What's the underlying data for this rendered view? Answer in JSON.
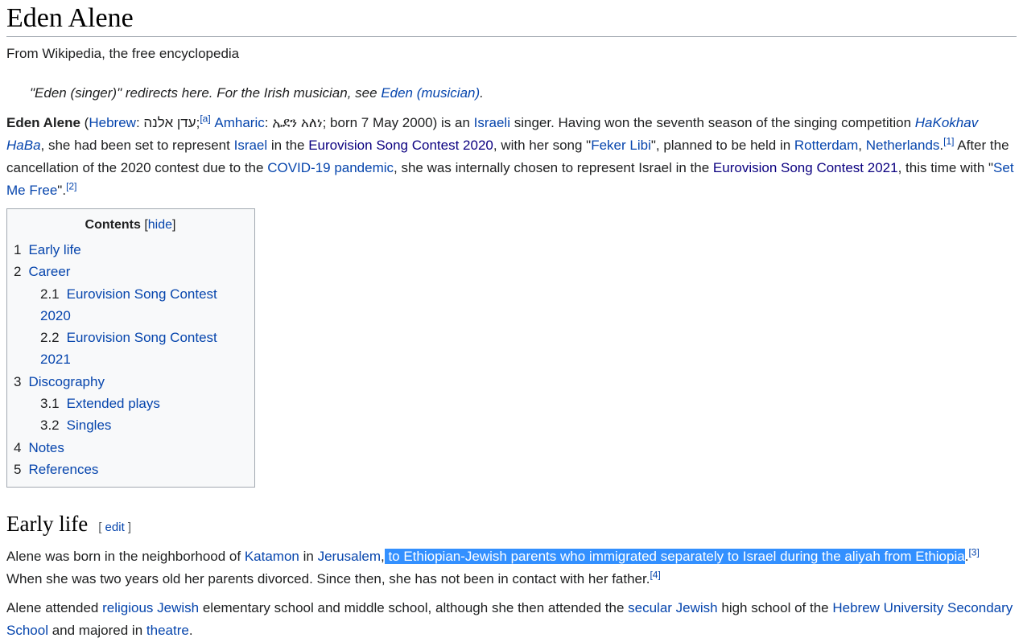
{
  "page": {
    "title": "Eden Alene",
    "tagline": "From Wikipedia, the free encyclopedia"
  },
  "hatnote": {
    "text": "\"Eden (singer)\" redirects here. For the Irish musician, see ",
    "link": "Eden (musician)",
    "end": "."
  },
  "lead": {
    "name": "Eden Alene",
    "t1": " (",
    "hebrew_link": "Hebrew",
    "t2": ": עדן אלנה;",
    "note_a": "[a]",
    "amharic_link": "Amharic",
    "t3": ": ኤደን አለነ; born 7 May 2000) is an ",
    "israeli_link": "Israeli",
    "t4": " singer. Having won the seventh season of the singing competition ",
    "hakokhav_link": "HaKokhav HaBa",
    "t5": ", she had been set to represent ",
    "israel_link": "Israel",
    "t6": " in the ",
    "esc2020_link": "Eurovision Song Contest 2020",
    "t7": ", with her song \"",
    "feker_link": "Feker Libi",
    "t8": "\", planned to be held in ",
    "rotterdam_link": "Rotterdam",
    "t9": ", ",
    "netherlands_link": "Netherlands",
    "t10": ".",
    "ref1": "[1]",
    "t11": " After the cancellation of the 2020 contest due to the ",
    "covid_link": "COVID-19 pandemic",
    "t12": ", she was internally chosen to represent Israel in the ",
    "esc2021_link": "Eurovision Song Contest 2021",
    "t13": ", this time with \"",
    "setme_link": "Set Me Free",
    "t14": "\".",
    "ref2": "[2]"
  },
  "toc": {
    "title": "Contents",
    "hide_open": "[",
    "hide_label": "hide",
    "hide_close": "]",
    "items": [
      {
        "num": "1",
        "label": "Early life"
      },
      {
        "num": "2",
        "label": "Career"
      },
      {
        "num": "2.1",
        "label": "Eurovision Song Contest 2020"
      },
      {
        "num": "2.2",
        "label": "Eurovision Song Contest 2021"
      },
      {
        "num": "3",
        "label": "Discography"
      },
      {
        "num": "3.1",
        "label": "Extended plays"
      },
      {
        "num": "3.2",
        "label": "Singles"
      },
      {
        "num": "4",
        "label": "Notes"
      },
      {
        "num": "5",
        "label": "References"
      }
    ]
  },
  "early_life": {
    "heading": "Early life",
    "edit_open": "[ ",
    "edit_label": "edit",
    "edit_close": " ]",
    "p1": {
      "t1": "Alene was born in the neighborhood of ",
      "katamon_link": "Katamon",
      "t2": " in ",
      "jerusalem_link": "Jerusalem",
      "t3": ",",
      "selected": " to Ethiopian-Jewish parents who immigrated separately to Israel during the aliyah from Ethiopia",
      "t4": ".",
      "ref3": "[3]",
      "t5": " When she was two years old her parents divorced. Since then, she has not been in contact with her father.",
      "ref4": "[4]"
    },
    "p2": {
      "t1": "Alene attended ",
      "religious_link": "religious Jewish",
      "t2": " elementary school and middle school, although she then attended the ",
      "secular_link": "secular Jewish",
      "t3": " high school of the ",
      "hebrewu_link": "Hebrew University Secondary School",
      "t4": " and majored in ",
      "theatre_link": "theatre",
      "t5": "."
    }
  },
  "colors": {
    "link": "#0645ad",
    "visited_link": "#0b0080",
    "selection": "#3390ff",
    "text": "#202122"
  }
}
